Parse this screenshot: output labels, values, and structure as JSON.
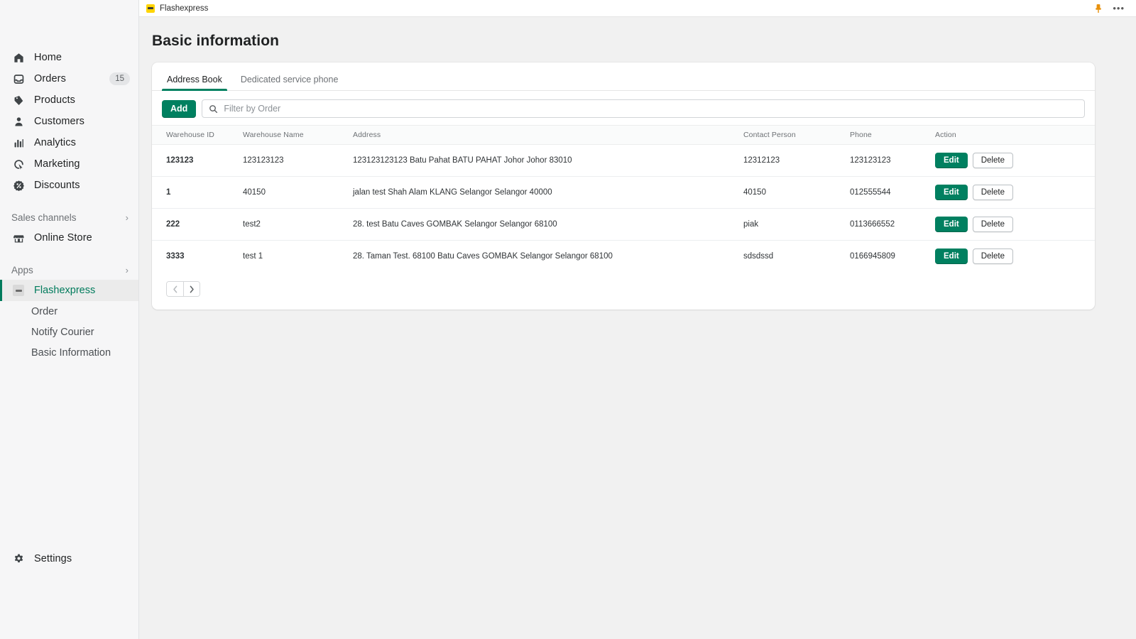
{
  "browser": {
    "tab_title": "Flashexpress",
    "tab_logo_icon": "flashexpress-logo-icon",
    "pin_icon": "pin-icon",
    "more_icon": "more-options-icon"
  },
  "sidebar": {
    "nav_items": [
      {
        "label": "Home",
        "icon": "home-icon",
        "badge": ""
      },
      {
        "label": "Orders",
        "icon": "orders-inbox-icon",
        "badge": "15"
      },
      {
        "label": "Products",
        "icon": "products-tag-icon",
        "badge": ""
      },
      {
        "label": "Customers",
        "icon": "customers-person-icon",
        "badge": ""
      },
      {
        "label": "Analytics",
        "icon": "analytics-bars-icon",
        "badge": ""
      },
      {
        "label": "Marketing",
        "icon": "marketing-cursor-icon",
        "badge": ""
      },
      {
        "label": "Discounts",
        "icon": "discounts-percent-icon",
        "badge": ""
      }
    ],
    "sales_channels": {
      "label": "Sales channels",
      "chevron": "›",
      "items": [
        {
          "label": "Online Store",
          "icon": "online-store-icon"
        }
      ]
    },
    "apps": {
      "label": "Apps",
      "chevron": "›",
      "active_app": {
        "label": "Flashexpress",
        "icon": "flashexpress-app-icon"
      },
      "sub_items": [
        {
          "label": "Order"
        },
        {
          "label": "Notify Courier"
        },
        {
          "label": "Basic Information"
        }
      ]
    },
    "settings": {
      "label": "Settings",
      "icon": "gear-icon"
    }
  },
  "main": {
    "page_title": "Basic information",
    "tabs": [
      {
        "label": "Address Book",
        "active": true
      },
      {
        "label": "Dedicated service phone",
        "active": false
      }
    ],
    "toolbar": {
      "add_label": "Add",
      "search_placeholder": "Filter by Order",
      "search_value": "",
      "search_icon": "search-icon"
    },
    "table": {
      "columns": [
        "Warehouse ID",
        "Warehouse Name",
        "Address",
        "Contact Person",
        "Phone",
        "Action"
      ],
      "rows": [
        {
          "warehouse_id": "123123",
          "warehouse_name": "123123123",
          "address": "123123123123 Batu Pahat BATU PAHAT Johor Johor 83010",
          "contact_person": "12312123",
          "phone": "123123123",
          "edit_label": "Edit",
          "delete_label": "Delete"
        },
        {
          "warehouse_id": "1",
          "warehouse_name": "40150",
          "address": "jalan test Shah Alam KLANG Selangor Selangor 40000",
          "contact_person": "40150",
          "phone": "012555544",
          "edit_label": "Edit",
          "delete_label": "Delete"
        },
        {
          "warehouse_id": "222",
          "warehouse_name": "test2",
          "address": "28. test Batu Caves GOMBAK Selangor Selangor 68100",
          "contact_person": "piak",
          "phone": "0113666552",
          "edit_label": "Edit",
          "delete_label": "Delete"
        },
        {
          "warehouse_id": "3333",
          "warehouse_name": "test 1",
          "address": "28. Taman Test. 68100 Batu Caves GOMBAK Selangor Selangor 68100",
          "contact_person": "sdsdssd",
          "phone": "0166945809",
          "edit_label": "Edit",
          "delete_label": "Delete"
        }
      ]
    },
    "pagination": {
      "prev_icon": "chevron-left-icon",
      "next_icon": "chevron-right-icon"
    }
  },
  "colors": {
    "brand_green": "#008060",
    "accent_bar": "#007b5c",
    "logo_yellow": "#ffd400",
    "pin_orange": "#e8910c",
    "sidebar_bg": "#f6f6f7",
    "canvas_bg": "#f1f1f1"
  }
}
